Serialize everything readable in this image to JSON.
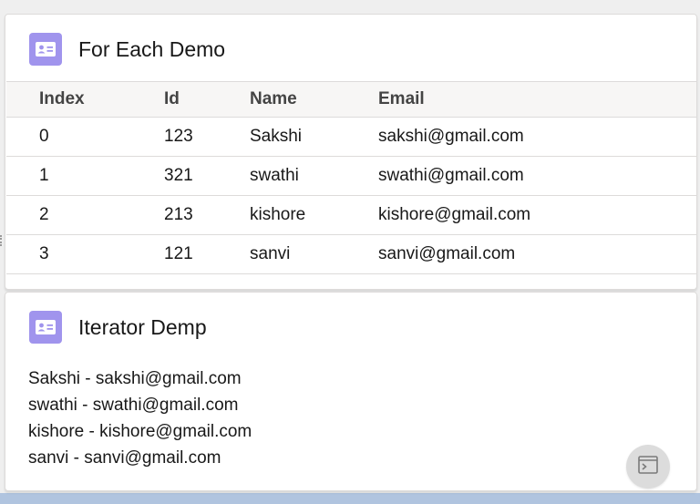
{
  "colors": {
    "icon_bg": "#a094ed",
    "border": "#dddbda",
    "header_bg": "#f7f6f5"
  },
  "card1": {
    "title": "For Each Demo",
    "icon": "contact-card-icon",
    "columns": [
      "Index",
      "Id",
      "Name",
      "Email"
    ],
    "rows": [
      [
        "0",
        "123",
        "Sakshi",
        "sakshi@gmail.com"
      ],
      [
        "1",
        "321",
        "swathi",
        "swathi@gmail.com"
      ],
      [
        "2",
        "213",
        "kishore",
        "kishore@gmail.com"
      ],
      [
        "3",
        "121",
        "sanvi",
        "sanvi@gmail.com"
      ]
    ]
  },
  "card2": {
    "title": "Iterator Demp",
    "icon": "contact-card-icon",
    "lines": [
      "Sakshi - sakshi@gmail.com",
      "swathi - swathi@gmail.com",
      "kishore - kishore@gmail.com",
      "sanvi - sanvi@gmail.com"
    ]
  },
  "utility": {
    "icon": "console-icon"
  }
}
